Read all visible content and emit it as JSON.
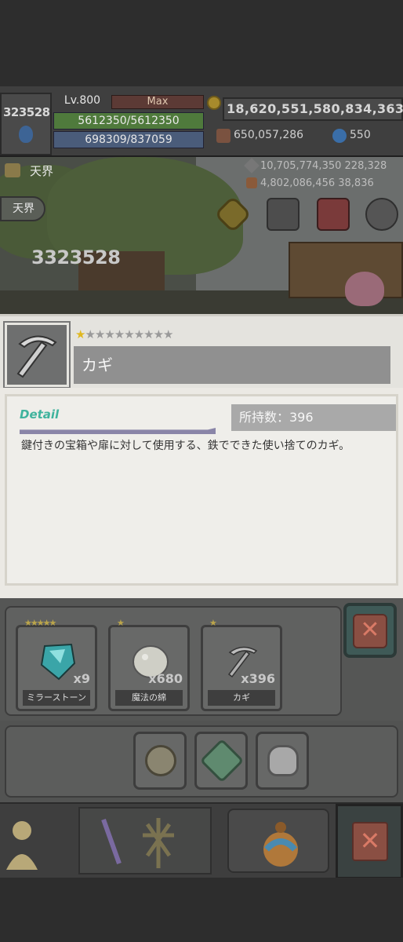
{
  "hud": {
    "power": "323528",
    "level": "Lv.800",
    "max_label": "Max",
    "hp": "5612350/5612350",
    "mp": "698309/837059",
    "gold": "18,620,551,580,834,363",
    "resource1": "650,057,286",
    "resource2": "550",
    "colors": {
      "hp_bar": "#4f7a3c",
      "mp_bar": "#4a5c7a",
      "max_bar": "#5c3a35"
    }
  },
  "scene": {
    "area_name": "天界",
    "back_label": "天界",
    "material1": "10,705,774,350",
    "material1_extra": "228,328",
    "material2": "4,802,086,456",
    "material2_extra": "38,836",
    "player_power": "3323528",
    "buttons": [
      "gold-coin-icon",
      "mask-icon",
      "shop-icon",
      "gear-icon"
    ]
  },
  "item": {
    "name": "カギ",
    "rarity_stars_lit": 1,
    "rarity_stars_total": 10,
    "detail_label": "Detail",
    "owned": "所持数：396",
    "description": "鍵付きの宝箱や扉に対して使用する、鉄でできた使い捨てのカギ。",
    "icon": "pickaxe-key-icon"
  },
  "inventory": {
    "items": [
      {
        "name": "ミラーストーン",
        "qty": "x9",
        "stars": "★★★★★",
        "icon": "mirror-stone-icon",
        "color": "#3aa5a8"
      },
      {
        "name": "魔法の綿",
        "qty": "x680",
        "stars": "★",
        "icon": "magic-cotton-icon",
        "color": "#cfcfc6"
      },
      {
        "name": "カギ",
        "qty": "x396",
        "stars": "★",
        "icon": "key-icon",
        "color": "#9a9a9a"
      }
    ]
  },
  "toolbar": {
    "buttons": [
      "compass-icon",
      "gem-icon",
      "potion-icon"
    ]
  },
  "nav": {
    "buttons": [
      "character-icon",
      "weapon-icon",
      "sword-icon",
      "bag-icon",
      "close-icon"
    ]
  }
}
